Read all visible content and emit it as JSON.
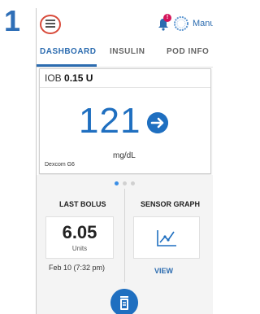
{
  "step_number": "1",
  "header": {
    "menu_icon": "hamburger-menu-icon",
    "notification_badge": "!",
    "mode_label": "Manual"
  },
  "tabs": [
    {
      "label": "DASHBOARD",
      "active": true
    },
    {
      "label": "INSULIN",
      "active": false
    },
    {
      "label": "POD INFO",
      "active": false
    }
  ],
  "iob": {
    "label": "IOB",
    "value": "0.15 U"
  },
  "glucose": {
    "value": "121",
    "unit": "mg/dL",
    "trend": "right-arrow-icon",
    "source": "Dexcom G6"
  },
  "carousel": {
    "count": 3,
    "active_index": 0
  },
  "last_bolus": {
    "title": "LAST BOLUS",
    "value": "6.05",
    "unit": "Units",
    "time": "Feb 10 (7:32 pm)"
  },
  "sensor_graph": {
    "title": "SENSOR GRAPH",
    "action": "VIEW"
  },
  "colors": {
    "accent": "#1f6fc0",
    "alert": "#d4145a",
    "highlight_ring": "#d84a3a"
  }
}
